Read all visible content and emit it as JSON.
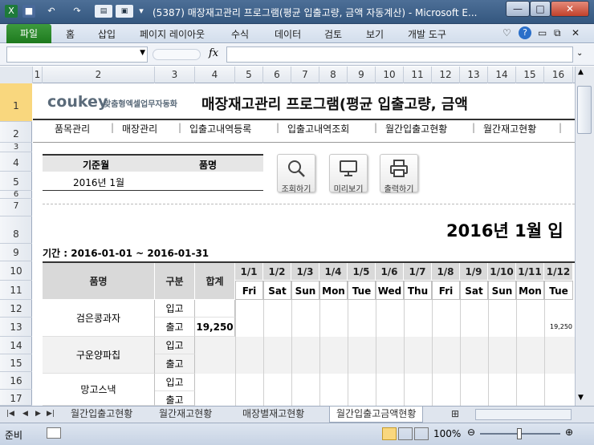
{
  "window": {
    "title": "(5387) 매장재고관리 프로그램(평균 입출고량, 금액 자동계산) - Microsoft E...",
    "minimize": "—",
    "maximize": "□",
    "close": "✕"
  },
  "ribbon": {
    "file": "파일",
    "tabs": [
      "홈",
      "삽입",
      "페이지 레이아웃",
      "수식",
      "데이터",
      "검토",
      "보기",
      "개발 도구"
    ]
  },
  "formula": {
    "fx": "fx",
    "value": ""
  },
  "columns": [
    "1",
    "2",
    "3",
    "4",
    "5",
    "6",
    "7",
    "8",
    "9",
    "10",
    "11",
    "12",
    "13",
    "14",
    "15",
    "16"
  ],
  "rows": [
    "1",
    "2",
    "3",
    "4",
    "5",
    "6",
    "7",
    "8",
    "9",
    "10",
    "11",
    "12",
    "13",
    "14",
    "15",
    "16",
    "17"
  ],
  "header": {
    "brand": "coukey",
    "brand_sub": "맞춤형엑셀업무자동화",
    "title": "매장재고관리 프로그램(평균 입출고량, 금액"
  },
  "nav": [
    "품목관리",
    "매장관리",
    "입출고내역등록",
    "입출고내역조회",
    "월간입출고현황",
    "월간재고현황"
  ],
  "filter": {
    "label_month": "기준월",
    "label_item": "품명",
    "month_value": "2016년 1월",
    "item_value": ""
  },
  "buttons": {
    "search": "조회하기",
    "preview": "미리보기",
    "print": "출력하기"
  },
  "report": {
    "big_title": "2016년 1월 입",
    "period": "기간 : 2016-01-01 ~ 2016-01-31"
  },
  "table": {
    "headers": {
      "item": "품명",
      "type": "구분",
      "total": "합계"
    },
    "dates": [
      "1/1",
      "1/2",
      "1/3",
      "1/4",
      "1/5",
      "1/6",
      "1/7",
      "1/8",
      "1/9",
      "1/10",
      "1/11",
      "1/12"
    ],
    "days": [
      "Fri",
      "Sat",
      "Sun",
      "Mon",
      "Tue",
      "Wed",
      "Thu",
      "Fri",
      "Sat",
      "Sun",
      "Mon",
      "Tue"
    ],
    "rows": [
      {
        "name": "검은콩과자",
        "in": "입고",
        "out": "출고",
        "total_in": "",
        "total_out": "19,250",
        "jan12_out": "19,250"
      },
      {
        "name": "구운양파칩",
        "in": "입고",
        "out": "출고",
        "total_in": "",
        "total_out": "",
        "jan12_out": ""
      },
      {
        "name": "망고스낵",
        "in": "입고",
        "out": "출고",
        "total_in": "",
        "total_out": "",
        "jan12_out": ""
      }
    ]
  },
  "sheets": [
    "월간입출고현황",
    "월간재고현황",
    "매장별재고현황",
    "월간입출고금액현황"
  ],
  "status": {
    "ready": "준비",
    "zoom": "100%"
  }
}
